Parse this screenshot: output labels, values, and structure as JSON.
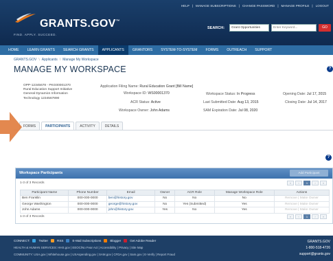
{
  "util_links": [
    "HELP",
    "MANAGE SUBSCRIPTIONS",
    "CHANGE PASSWORD",
    "MANAGE PROFILE",
    "LOGOUT"
  ],
  "logo": {
    "name": "GRANTS.GOV",
    "mark": "™",
    "tagline": "FIND. APPLY. SUCCEED."
  },
  "search": {
    "label": "SEARCH:",
    "scope": "Grant Opportunities",
    "placeholder": "Enter Keyword...",
    "go": "GO"
  },
  "nav": [
    "HOME",
    "LEARN GRANTS",
    "SEARCH GRANTS",
    "APPLICANTS",
    "GRANTORS",
    "SYSTEM-TO-SYSTEM",
    "FORMS",
    "OUTREACH",
    "SUPPORT"
  ],
  "breadcrumb": [
    "GRANTS.GOV",
    "Applicants",
    "Manage My Workspace"
  ],
  "page_title": "MANAGE MY WORKSPACE",
  "opportunity": {
    "number": "OPP-12345678 - PKG00001370",
    "line1": "Rural Education Support Initiative",
    "line2": "General Dynamics Information",
    "line3": "Technology 1234567890"
  },
  "workspace": {
    "filing_name_label": "Application Filing Name:",
    "filing_name": "Rural Education Grant [Bill Name]",
    "id_label": "Workspace ID:",
    "id": "WS00001370",
    "acr_label": "ACR Status:",
    "acr": "Active",
    "owner_label": "Workspace Owner:",
    "owner": "John Adams",
    "status_label": "Workspace Status:",
    "status": "In Progress",
    "last_sub_label": "Last Submitted Date:",
    "last_sub": "Aug 13, 2015",
    "sam_label": "SAM Expiration Date:",
    "sam": "Jul 08, 2020",
    "opening_label": "Opening Date:",
    "opening": "Jul 17, 2015",
    "closing_label": "Closing Date:",
    "closing": "Jul 14, 2017"
  },
  "tabs": [
    "FORMS",
    "PARTICIPANTS",
    "ACTIVITY",
    "DETAILS"
  ],
  "participants": {
    "title": "Workspace Participants",
    "add_button": "Add Participant",
    "records_top": "1-3 of 3 Records",
    "records_bottom": "1-3 of 3 Records",
    "pager": [
      "«",
      "‹",
      "1",
      "›",
      "»"
    ],
    "columns": [
      "Participant Name",
      "Phone Number",
      "Email",
      "Owner",
      "ACR Role",
      "Manage Workspace Role",
      "Actions"
    ],
    "rows": [
      [
        "Ben Franklin",
        "000-000-0000",
        "ben@history.gov",
        "No",
        "No",
        "No",
        "Remove | Make Owner"
      ],
      [
        "George Washington",
        "000-000-0000",
        "george@history.gov",
        "No",
        "Yes (Submitted)",
        "Yes",
        "Remove | Make Owner"
      ],
      [
        "John Adams",
        "000-000-0000",
        "john@history.gov",
        "Yes",
        "No",
        "Yes",
        "Remove | Make Owner"
      ]
    ]
  },
  "footer": {
    "connect": "CONNECT:",
    "social": [
      "Twitter",
      "RSS",
      "E-Mail Subscriptions",
      "Blogger",
      "Get Adobe Reader"
    ],
    "line2": "HEALTH & HUMAN SERVICES: HHS.gov | EEOC/No Fear Act | Accessibility | Privacy | Site Map",
    "line3": "COMMUNITY: USA.gov | Whitehouse.gov | USAspending.gov | SAM.gov | CFDA.gov | Sam.gov | E-Verify | Report Fraud",
    "right": [
      "GRANTS.GOV",
      "1-800-518-4726",
      "support@grants.gov"
    ]
  },
  "colors": {
    "header": "#0f2a4f",
    "nav": "#2e6da4",
    "panel_head": "#3d72ad",
    "arrow": "#e07b3c"
  }
}
